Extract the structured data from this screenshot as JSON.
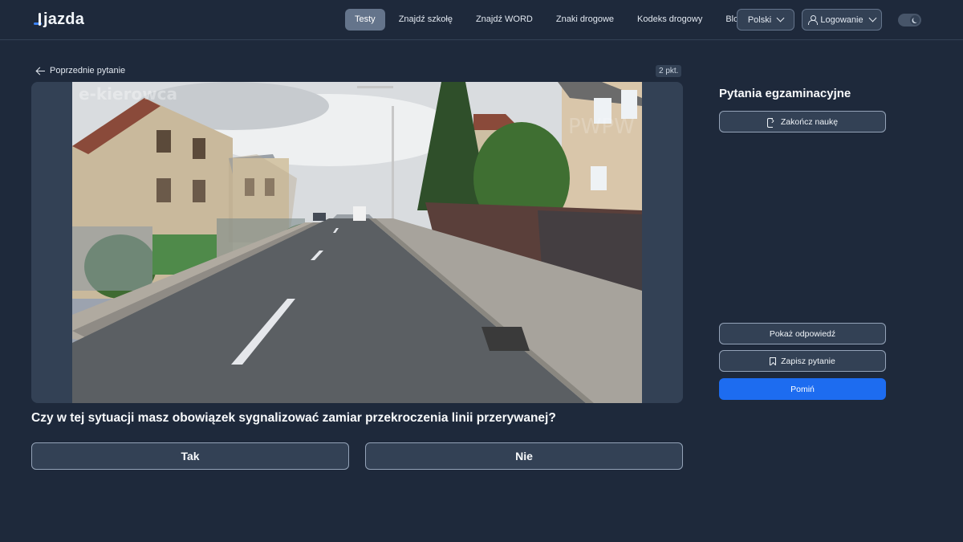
{
  "header": {
    "logo_text": "jazda",
    "nav": [
      {
        "label": "Testy",
        "active": true
      },
      {
        "label": "Znajdź szkołę",
        "active": false
      },
      {
        "label": "Znajdź WORD",
        "active": false
      },
      {
        "label": "Znaki drogowe",
        "active": false
      },
      {
        "label": "Kodeks drogowy",
        "active": false
      },
      {
        "label": "Blog",
        "active": false
      }
    ],
    "language_label": "Polski",
    "login_label": "Logowanie",
    "theme_toggle_icon": "moon-icon"
  },
  "question_panel": {
    "prev_label": "Poprzednie pytanie",
    "points": "2 pkt.",
    "question_text": "Czy w tej sytuacji masz obowiązek sygnalizować zamiar przekroczenia linii przerywanej?",
    "answers": [
      "Tak",
      "Nie"
    ]
  },
  "sidebar": {
    "title": "Pytania egzaminacyjne",
    "end_label": "Zakończ naukę",
    "show_answer_label": "Pokaż odpowiedź",
    "save_label": "Zapisz pytanie",
    "skip_label": "Pomiń"
  },
  "colors": {
    "background": "#1e293b",
    "panel": "#334155",
    "accent": "#1d6cf0",
    "nav_active": "#64748b"
  }
}
